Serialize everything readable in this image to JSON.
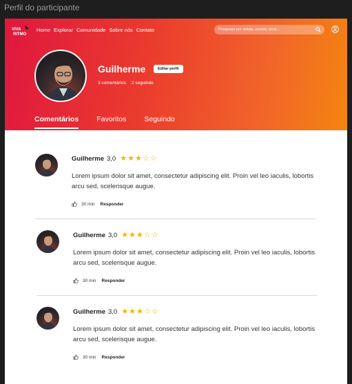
{
  "window": {
    "title": "Perfil do participante"
  },
  "nav": {
    "links": [
      "Home",
      "Explorar",
      "Comunidade",
      "Sobre nós",
      "Contato"
    ],
    "search_placeholder": "Pesquisar por artista, evento, local..."
  },
  "colors": {
    "brand_start": "#e0173f",
    "brand_end": "#f4850f",
    "star": "#f4b400"
  },
  "profile": {
    "name": "Guilherme",
    "edit_label": "Editar perfil",
    "comments_count": "3 comentários",
    "following_count": "2 seguindo"
  },
  "tabs": [
    {
      "label": "Comentários",
      "active": true
    },
    {
      "label": "Favoritos",
      "active": false
    },
    {
      "label": "Seguindo",
      "active": false
    }
  ],
  "comments": [
    {
      "author": "Guilherme",
      "rating": "3,0",
      "stars": 3,
      "max_stars": 5,
      "text": "Lorem ipsum dolor sit amet, consectetur adipiscing elit. Proin vel leo iaculis, lobortis arcu sed, scelerisque augue.",
      "time": "30 min",
      "reply_label": "Responder"
    },
    {
      "author": "Guilherme",
      "rating": "3,0",
      "stars": 3,
      "max_stars": 5,
      "text": "Lorem ipsum dolor sit amet, consectetur adipiscing elit. Proin vel leo iaculis, lobortis arcu sed, scelerisque augue.",
      "time": "30 min",
      "reply_label": "Responder"
    },
    {
      "author": "Guilherme",
      "rating": "3,0",
      "stars": 3,
      "max_stars": 5,
      "text": "Lorem ipsum dolor sit amet, consectetur adipiscing elit. Proin vel leo iaculis, lobortis arcu sed, scelerisque augue.",
      "time": "30 min",
      "reply_label": "Responder"
    }
  ]
}
